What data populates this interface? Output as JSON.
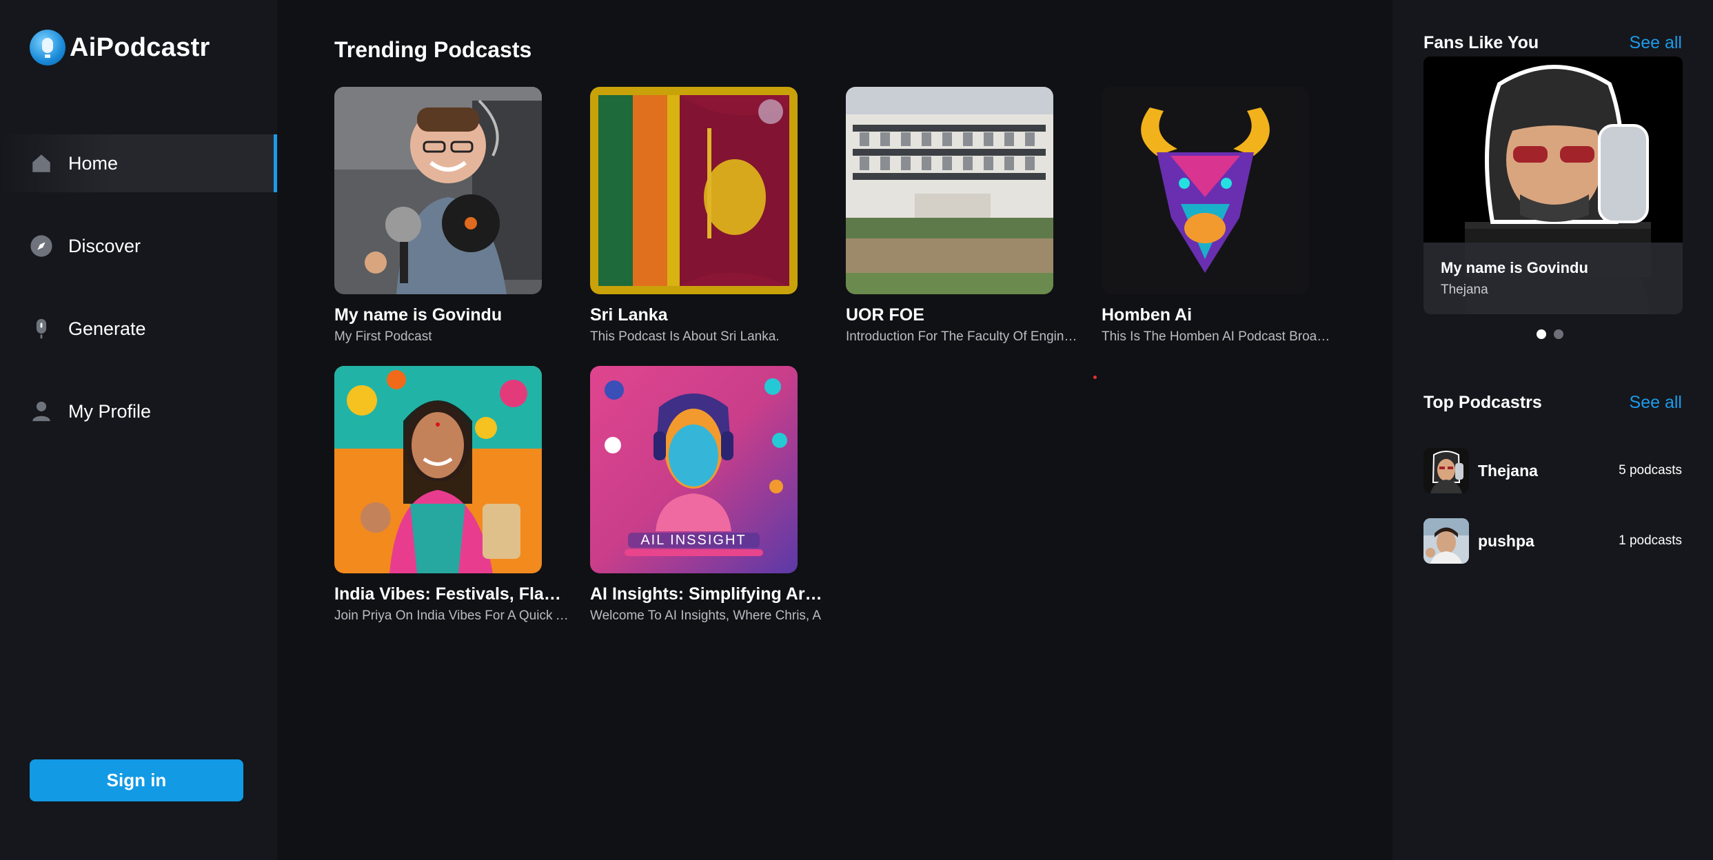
{
  "brand": {
    "name": "AiPodcastr"
  },
  "nav": {
    "items": [
      {
        "label": "Home",
        "icon": "home-icon",
        "active": true
      },
      {
        "label": "Discover",
        "icon": "compass-icon",
        "active": false
      },
      {
        "label": "Generate",
        "icon": "microphone-icon",
        "active": false
      },
      {
        "label": "My Profile",
        "icon": "user-icon",
        "active": false
      }
    ],
    "signin_label": "Sign in"
  },
  "main": {
    "title": "Trending Podcasts",
    "podcasts": [
      {
        "title": "My name is Govindu",
        "description": "My First Podcast"
      },
      {
        "title": "Sri Lanka",
        "description": "This Podcast Is About Sri Lanka."
      },
      {
        "title": "UOR FOE",
        "description": "Introduction For The Faculty Of Engineering"
      },
      {
        "title": "Homben Ai",
        "description": "This Is The Homben AI Podcast Broadcast"
      },
      {
        "title": "India Vibes: Festivals, Flavors",
        "description": "Join Priya On India Vibes For A Quick And"
      },
      {
        "title": "AI Insights: Simplifying Artificial",
        "description": "Welcome To AI Insights, Where Chris, A"
      }
    ],
    "thumb_texts": {
      "ai_insights_banner": "AIL INSSIGHT"
    }
  },
  "right": {
    "fans": {
      "title": "Fans Like You",
      "see_all": "See all",
      "card": {
        "title": "My name is Govindu",
        "author": "Thejana"
      },
      "carousel_active_index": 0,
      "carousel_count": 2
    },
    "top": {
      "title": "Top Podcastrs",
      "see_all": "See all",
      "items": [
        {
          "name": "Thejana",
          "count": "5 podcasts"
        },
        {
          "name": "pushpa",
          "count": "1 podcasts"
        }
      ]
    }
  },
  "colors": {
    "accent": "#129ae5",
    "background": "#101114",
    "sidebar": "#15171c"
  }
}
